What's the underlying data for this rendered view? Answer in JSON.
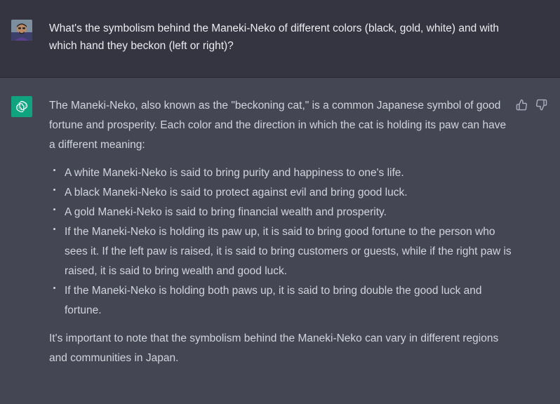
{
  "user_message": {
    "text": "What's the symbolism behind the Maneki-Neko of different colors (black, gold, white) and with which hand they beckon (left or right)?"
  },
  "assistant_message": {
    "intro": "The Maneki-Neko, also known as the \"beckoning cat,\" is a common Japanese symbol of good fortune and prosperity. Each color and the direction in which the cat is holding its paw can have a different meaning:",
    "bullets": [
      "A white Maneki-Neko is said to bring purity and happiness to one's life.",
      "A black Maneki-Neko is said to protect against evil and bring good luck.",
      "A gold Maneki-Neko is said to bring financial wealth and prosperity.",
      "If the Maneki-Neko is holding its paw up, it is said to bring good fortune to the person who sees it. If the left paw is raised, it is said to bring customers or guests, while if the right paw is raised, it is said to bring wealth and good luck.",
      "If the Maneki-Neko is holding both paws up, it is said to bring double the good luck and fortune."
    ],
    "closing": "It's important to note that the symbolism behind the Maneki-Neko can vary in different regions and communities in Japan."
  },
  "icons": {
    "user_avatar": "avatar",
    "bot_avatar": "openai-logo-icon",
    "like": "thumbs-up-icon",
    "dislike": "thumbs-down-icon"
  },
  "colors": {
    "user_bg": "#343541",
    "assistant_bg": "#444654",
    "bot_avatar_bg": "#10a37f",
    "text": "#d1d5db"
  }
}
